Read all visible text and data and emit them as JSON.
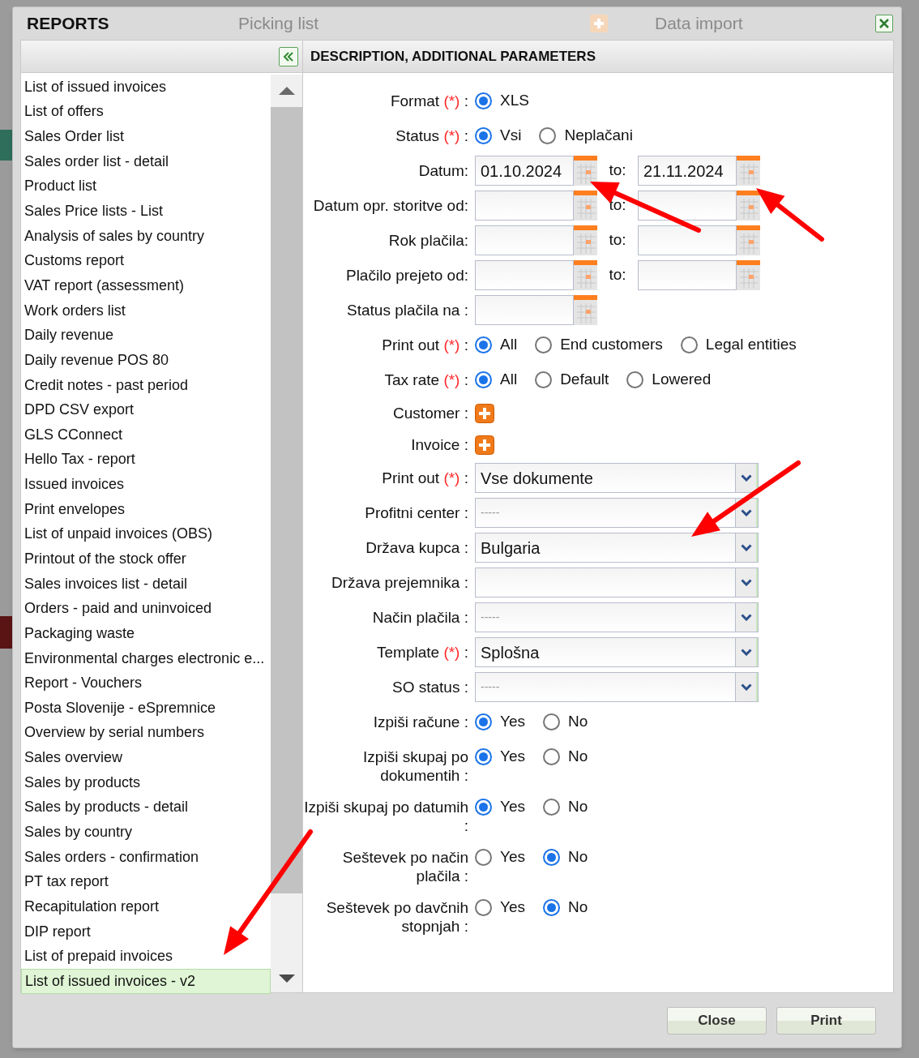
{
  "background": {
    "tiles": [
      "Picking list",
      "Data import"
    ]
  },
  "dialog": {
    "title": "REPORTS",
    "panel_title": "DESCRIPTION, ADDITIONAL PARAMETERS"
  },
  "reports": [
    {
      "label": "List of issued invoices",
      "selected": false
    },
    {
      "label": "List of offers",
      "selected": false
    },
    {
      "label": "Sales Order list",
      "selected": false
    },
    {
      "label": "Sales order list - detail",
      "selected": false
    },
    {
      "label": "Product list",
      "selected": false
    },
    {
      "label": "Sales Price lists - List",
      "selected": false
    },
    {
      "label": "Analysis of sales by country",
      "selected": false
    },
    {
      "label": "Customs report",
      "selected": false
    },
    {
      "label": "VAT report (assessment)",
      "selected": false
    },
    {
      "label": "Work orders list",
      "selected": false
    },
    {
      "label": "Daily revenue",
      "selected": false
    },
    {
      "label": "Daily revenue POS 80",
      "selected": false
    },
    {
      "label": "Credit notes - past period",
      "selected": false
    },
    {
      "label": "DPD CSV export",
      "selected": false
    },
    {
      "label": "GLS CConnect",
      "selected": false
    },
    {
      "label": "Hello Tax - report",
      "selected": false
    },
    {
      "label": "Issued invoices",
      "selected": false
    },
    {
      "label": "Print envelopes",
      "selected": false
    },
    {
      "label": "List of unpaid invoices (OBS)",
      "selected": false
    },
    {
      "label": "Printout of the stock offer",
      "selected": false
    },
    {
      "label": "Sales invoices list - detail",
      "selected": false
    },
    {
      "label": "Orders - paid and uninvoiced",
      "selected": false
    },
    {
      "label": "Packaging waste",
      "selected": false
    },
    {
      "label": "Environmental charges electronic e...",
      "selected": false
    },
    {
      "label": "Report - Vouchers",
      "selected": false
    },
    {
      "label": "Posta Slovenije - eSpremnice",
      "selected": false
    },
    {
      "label": "Overview by serial numbers",
      "selected": false
    },
    {
      "label": "Sales overview",
      "selected": false
    },
    {
      "label": "Sales by products",
      "selected": false
    },
    {
      "label": "Sales by products - detail",
      "selected": false
    },
    {
      "label": "Sales by country",
      "selected": false
    },
    {
      "label": "Sales orders - confirmation",
      "selected": false
    },
    {
      "label": "PT tax report",
      "selected": false
    },
    {
      "label": "Recapitulation report",
      "selected": false
    },
    {
      "label": "DIP report",
      "selected": false
    },
    {
      "label": "List of prepaid invoices",
      "selected": false
    },
    {
      "label": "List of issued invoices - v2",
      "selected": true
    }
  ],
  "form": [
    {
      "kind": "radio",
      "label": "Format",
      "mark": "(*)",
      "colon": ":",
      "options": [
        {
          "label": "XLS",
          "selected": true
        }
      ]
    },
    {
      "kind": "radio",
      "label": "Status",
      "mark": "(*)",
      "colon": ":",
      "options": [
        {
          "label": "Vsi",
          "selected": true
        },
        {
          "label": "Neplačani",
          "selected": false
        }
      ]
    },
    {
      "kind": "range",
      "label": "Datum:",
      "from": "01.10.2024",
      "to_label": "to:",
      "to": "21.11.2024"
    },
    {
      "kind": "range",
      "label": "Datum opr. storitve od:",
      "to_label": "to:"
    },
    {
      "kind": "range",
      "label": "Rok plačila:",
      "to_label": "to:"
    },
    {
      "kind": "range",
      "label": "Plačilo prejeto od:",
      "to_label": "to:"
    },
    {
      "kind": "date",
      "label": "Status plačila na :"
    },
    {
      "kind": "radio",
      "label": "Print out",
      "mark": "(*)",
      "colon": ":",
      "options": [
        {
          "label": "All",
          "selected": true
        },
        {
          "label": "End customers",
          "selected": false
        },
        {
          "label": "Legal entities",
          "selected": false
        }
      ]
    },
    {
      "kind": "radio",
      "label": "Tax rate",
      "mark": "(*)",
      "colon": ":",
      "options": [
        {
          "label": "All",
          "selected": true
        },
        {
          "label": "Default",
          "selected": false
        },
        {
          "label": "Lowered",
          "selected": false
        }
      ]
    },
    {
      "kind": "add",
      "label": "Customer :"
    },
    {
      "kind": "add",
      "label": "Invoice :"
    },
    {
      "kind": "select",
      "label": "Print out",
      "mark": "(*)",
      "colon": ":",
      "value": "Vse dokumente"
    },
    {
      "kind": "select",
      "label": "Profitni center :",
      "placeholder": "-----"
    },
    {
      "kind": "select",
      "label": "Država kupca :",
      "value": "Bulgaria"
    },
    {
      "kind": "select",
      "label": "Država prejemnika :"
    },
    {
      "kind": "select",
      "label": "Način plačila :",
      "placeholder": "-----"
    },
    {
      "kind": "select",
      "label": "Template",
      "mark": "(*)",
      "colon": ":",
      "value": "Splošna"
    },
    {
      "kind": "select",
      "label": "SO status :",
      "placeholder": "-----"
    },
    {
      "kind": "yesno",
      "label": "Izpiši račune :",
      "options": [
        {
          "label": "Yes",
          "selected": true
        },
        {
          "label": "No",
          "selected": false
        }
      ]
    },
    {
      "kind": "yesno",
      "label": "Izpiši skupaj po dokumentih :",
      "options": [
        {
          "label": "Yes",
          "selected": true
        },
        {
          "label": "No",
          "selected": false
        }
      ]
    },
    {
      "kind": "yesno",
      "label": "Izpiši skupaj po datumih :",
      "options": [
        {
          "label": "Yes",
          "selected": true
        },
        {
          "label": "No",
          "selected": false
        }
      ]
    },
    {
      "kind": "yesno",
      "label": "Seštevek po način plačila :",
      "options": [
        {
          "label": "Yes",
          "selected": false
        },
        {
          "label": "No",
          "selected": true
        }
      ]
    },
    {
      "kind": "yesno",
      "label": "Seštevek po davčnih stopnjah :",
      "options": [
        {
          "label": "Yes",
          "selected": false
        },
        {
          "label": "No",
          "selected": true
        }
      ]
    }
  ],
  "buttons": [
    "Close",
    "Print"
  ]
}
